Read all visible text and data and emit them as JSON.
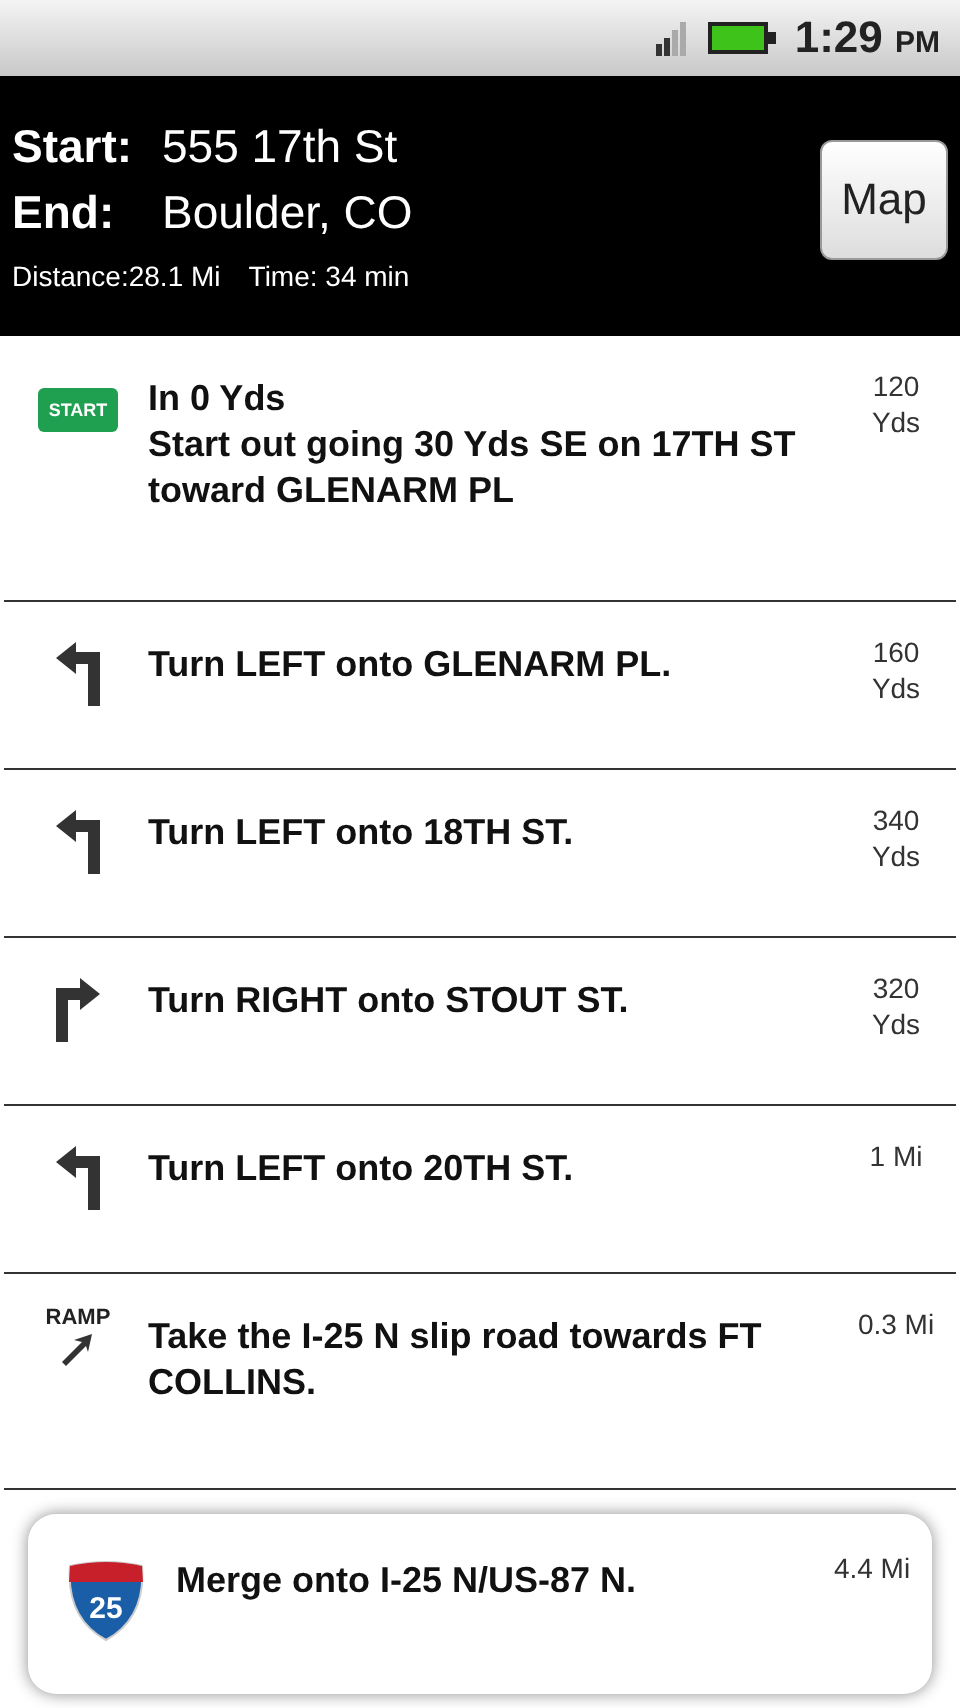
{
  "status_bar": {
    "time": "1:29",
    "ampm": "PM"
  },
  "header": {
    "start_label": "Start:",
    "start_value": "555 17th St",
    "end_label": "End:",
    "end_value": "Boulder, CO",
    "distance": "Distance:28.1 Mi",
    "time": "Time: 34 min",
    "map_button": "Map"
  },
  "steps": [
    {
      "kind": "start",
      "badge": "START",
      "heading": "In 0 Yds",
      "text": "Start out going 30 Yds SE on 17TH ST toward GLENARM PL",
      "distance": "120 Yds",
      "selected": false
    },
    {
      "kind": "left",
      "text": "Turn LEFT onto GLENARM PL.",
      "distance": "160 Yds",
      "selected": false
    },
    {
      "kind": "left",
      "text": "Turn LEFT onto 18TH ST.",
      "distance": "340 Yds",
      "selected": false
    },
    {
      "kind": "right",
      "text": "Turn RIGHT onto STOUT ST.",
      "distance": "320 Yds",
      "selected": false
    },
    {
      "kind": "left",
      "text": "Turn LEFT onto 20TH ST.",
      "distance": "1 Mi",
      "selected": false
    },
    {
      "kind": "ramp",
      "badge": "RAMP",
      "text": "Take the I-25 N slip road towards FT COLLINS.",
      "distance": "0.3 Mi",
      "selected": false
    },
    {
      "kind": "interstate",
      "badge": "25",
      "text": "Merge onto I-25 N/US-87 N.",
      "distance": "4.4 Mi",
      "selected": true
    }
  ]
}
